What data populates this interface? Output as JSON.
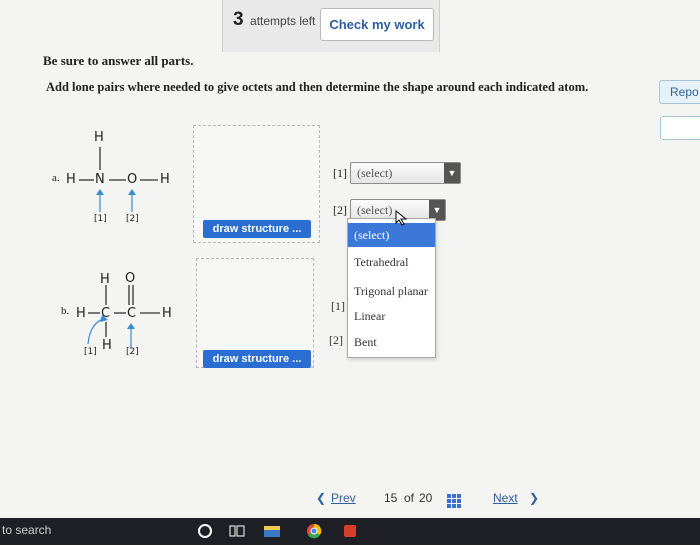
{
  "header": {
    "attempts_number": "3",
    "attempts_label": "attempts left",
    "check_button": "Check my work",
    "report_button": "Repo"
  },
  "instructions": {
    "line1": "Be sure to answer all parts.",
    "line2": "Add lone pairs where needed to give octets and then determine the shape around each indicated atom."
  },
  "part_a": {
    "prefix": "a.",
    "atoms": [
      "H",
      "N",
      "O",
      "H",
      "H"
    ],
    "marker1": "[1]",
    "marker2": "[2]",
    "draw_button": "draw structure ...",
    "select1_label": "[1]",
    "select1_value": "(select)",
    "select2_label": "[2]",
    "select2_value": "(select)"
  },
  "part_b": {
    "prefix": "b.",
    "atoms": [
      "H",
      "O",
      "H",
      "C",
      "C",
      "H",
      "H"
    ],
    "marker1": "[1]",
    "marker2": "[2]",
    "draw_button": "draw structure ...",
    "label1": "[1]",
    "label2": "[2]"
  },
  "dropdown": {
    "options": [
      "(select)",
      "Tetrahedral",
      "Trigonal planar",
      "Linear",
      "Bent"
    ],
    "highlighted": "(select)"
  },
  "pager": {
    "prev": "Prev",
    "current": "15",
    "of": "of",
    "total": "20",
    "next": "Next"
  },
  "taskbar": {
    "search_text": "to search",
    "icons": [
      "cortana-icon",
      "task-view-icon",
      "file-explorer-icon",
      "chrome-icon",
      "app-icon"
    ]
  },
  "colors": {
    "accent_blue": "#2a6ed2",
    "selection_blue": "#3b78d8",
    "taskbar": "#1f2025"
  }
}
